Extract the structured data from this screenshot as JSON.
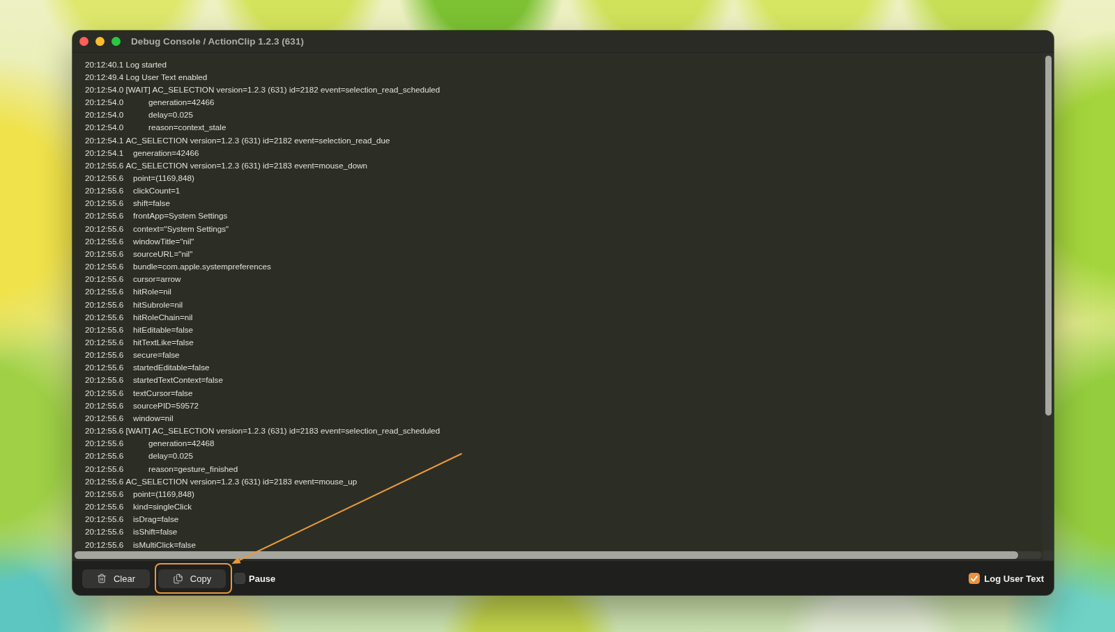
{
  "window": {
    "title": "Debug Console / ActionClip 1.2.3 (631)"
  },
  "log": [
    {
      "kind": "message",
      "time": "20:12:40.1",
      "message": "Log started"
    },
    {
      "kind": "message",
      "time": "20:12:49.4",
      "message": "Log User Text enabled"
    },
    {
      "kind": "wait",
      "time": "20:12:54.0",
      "message": "[WAIT] AC_SELECTION version=1.2.3 (631) id=2182 event=selection_read_scheduled",
      "children": [
        {
          "time": "20:12:54.0",
          "message": "generation=42466"
        },
        {
          "time": "20:12:54.0",
          "message": "delay=0.025"
        },
        {
          "time": "20:12:54.0",
          "message": "reason=context_stale"
        }
      ]
    },
    {
      "kind": "event",
      "time": "20:12:54.1",
      "message": "AC_SELECTION version=1.2.3 (631) id=2182 event=selection_read_due",
      "children": [
        {
          "time": "20:12:54.1",
          "message": "generation=42466"
        }
      ]
    },
    {
      "kind": "event",
      "time": "20:12:55.6",
      "message": "AC_SELECTION version=1.2.3 (631) id=2183 event=mouse_down",
      "children": [
        {
          "time": "20:12:55.6",
          "message": "point=(1169,848)"
        },
        {
          "time": "20:12:55.6",
          "message": "clickCount=1"
        },
        {
          "time": "20:12:55.6",
          "message": "shift=false"
        },
        {
          "time": "20:12:55.6",
          "message": "frontApp=System Settings"
        },
        {
          "time": "20:12:55.6",
          "message": "context=\"System Settings\""
        },
        {
          "time": "20:12:55.6",
          "message": "windowTitle=\"nil\""
        },
        {
          "time": "20:12:55.6",
          "message": "sourceURL=\"nil\""
        },
        {
          "time": "20:12:55.6",
          "message": "bundle=com.apple.systempreferences"
        },
        {
          "time": "20:12:55.6",
          "message": "cursor=arrow"
        },
        {
          "time": "20:12:55.6",
          "message": "hitRole=nil"
        },
        {
          "time": "20:12:55.6",
          "message": "hitSubrole=nil"
        },
        {
          "time": "20:12:55.6",
          "message": "hitRoleChain=nil"
        },
        {
          "time": "20:12:55.6",
          "message": "hitEditable=false"
        },
        {
          "time": "20:12:55.6",
          "message": "hitTextLike=false"
        },
        {
          "time": "20:12:55.6",
          "message": "secure=false"
        },
        {
          "time": "20:12:55.6",
          "message": "startedEditable=false"
        },
        {
          "time": "20:12:55.6",
          "message": "startedTextContext=false"
        },
        {
          "time": "20:12:55.6",
          "message": "textCursor=false"
        },
        {
          "time": "20:12:55.6",
          "message": "sourcePID=59572"
        },
        {
          "time": "20:12:55.6",
          "message": "window=nil"
        }
      ]
    },
    {
      "kind": "wait",
      "time": "20:12:55.6",
      "message": "[WAIT] AC_SELECTION version=1.2.3 (631) id=2183 event=selection_read_scheduled",
      "children": [
        {
          "time": "20:12:55.6",
          "message": "generation=42468"
        },
        {
          "time": "20:12:55.6",
          "message": "delay=0.025"
        },
        {
          "time": "20:12:55.6",
          "message": "reason=gesture_finished"
        }
      ]
    },
    {
      "kind": "event",
      "time": "20:12:55.6",
      "message": "AC_SELECTION version=1.2.3 (631) id=2183 event=mouse_up",
      "children": [
        {
          "time": "20:12:55.6",
          "message": "point=(1169,848)"
        },
        {
          "time": "20:12:55.6",
          "message": "kind=singleClick"
        },
        {
          "time": "20:12:55.6",
          "message": "isDrag=false"
        },
        {
          "time": "20:12:55.6",
          "message": "isShift=false"
        },
        {
          "time": "20:12:55.6",
          "message": "isMultiClick=false"
        }
      ]
    }
  ],
  "toolbar": {
    "buttons": [
      {
        "label": "Clear",
        "highlighted": false
      },
      {
        "label": "Copy",
        "highlighted": true
      }
    ],
    "pause": {
      "label": "Pause",
      "checked": false
    },
    "log_user_text": {
      "label": "Log User Text",
      "checked": true
    }
  }
}
